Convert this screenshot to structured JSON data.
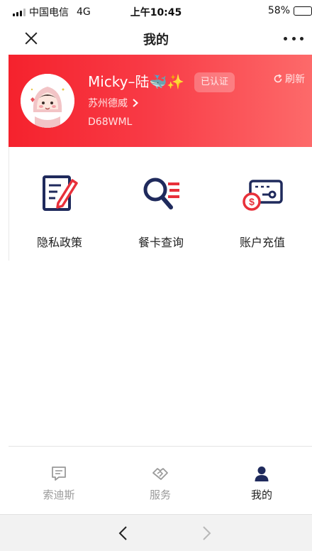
{
  "status_bar": {
    "carrier": "中国电信",
    "network": "4G",
    "time": "上午10:45",
    "battery": "58%",
    "battery_level": 0.58,
    "battery_color": "#4cd964"
  },
  "nav": {
    "title": "我的",
    "close_icon": "close-icon",
    "more_icon": "more-icon"
  },
  "profile": {
    "name": "Micky–陆🐳✨",
    "verified_label": "已认证",
    "refresh_label": "刷新",
    "location": "苏州德威",
    "code": "D68WML",
    "banner_colors": [
      "#f5222d",
      "#fd6a6a"
    ]
  },
  "menu": {
    "items": [
      {
        "label": "隐私政策",
        "icon": "privacy-policy-icon"
      },
      {
        "label": "餐卡查询",
        "icon": "card-search-icon"
      },
      {
        "label": "账户充值",
        "icon": "recharge-icon"
      }
    ],
    "icon_colors": {
      "primary": "#1f2a5c",
      "accent": "#e8303a"
    }
  },
  "tab_bar": {
    "items": [
      {
        "label": "索迪斯",
        "icon": "message-icon",
        "active": false
      },
      {
        "label": "服务",
        "icon": "handshake-icon",
        "active": false
      },
      {
        "label": "我的",
        "icon": "user-icon",
        "active": true
      }
    ]
  },
  "browser": {
    "back_icon": "back-arrow-icon",
    "forward_icon": "forward-arrow-icon"
  }
}
